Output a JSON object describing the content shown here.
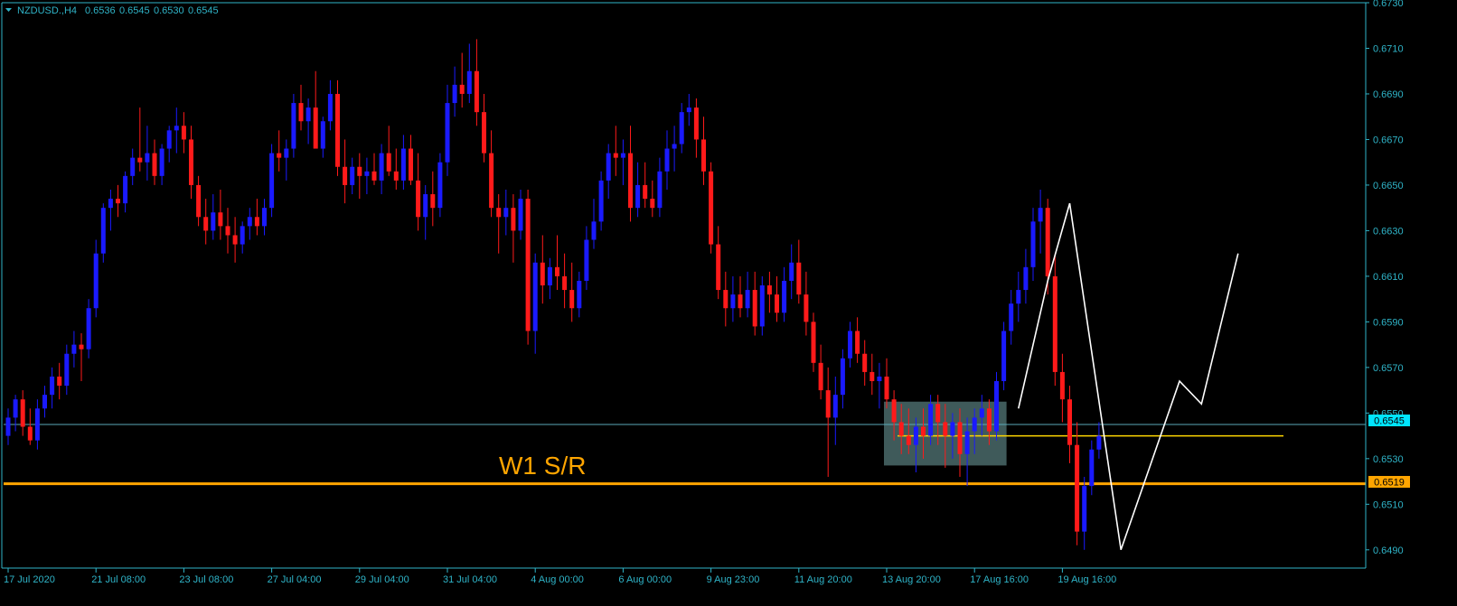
{
  "window": {
    "symbol_label": "NZDUSD.,H4",
    "ohlc": [
      "0.6536",
      "0.6545",
      "0.6530",
      "0.6545"
    ]
  },
  "colors": {
    "background": "#000000",
    "axis": "#2fb4c8",
    "bull": "#1a1aff",
    "bear": "#ff1a1a",
    "bid_line": "#5aa9b8",
    "support": "#ffa500",
    "zone_line": "#ffd700",
    "zone_box": "#4a6a6a",
    "projection": "#ffffff",
    "price_tag_current": "#00e5ff",
    "price_tag_support": "#ffa500"
  },
  "annotations": {
    "level_label": "W1 S/R",
    "current_price_tag": "0.6545",
    "support_price_tag": "0.6519"
  },
  "chart_data": {
    "type": "candlestick",
    "title": "",
    "xlabel": "",
    "ylabel": "",
    "ylim": [
      0.6482,
      0.673
    ],
    "y_ticks": [
      "0.6730",
      "0.6710",
      "0.6690",
      "0.6670",
      "0.6650",
      "0.6630",
      "0.6610",
      "0.6590",
      "0.6570",
      "0.6550",
      "0.6530",
      "0.6510",
      "0.6490"
    ],
    "x_ticks": [
      {
        "label": "17 Jul 2020",
        "index": 0
      },
      {
        "label": "21 Jul 08:00",
        "index": 12
      },
      {
        "label": "23 Jul 08:00",
        "index": 24
      },
      {
        "label": "27 Jul 04:00",
        "index": 36
      },
      {
        "label": "29 Jul 04:00",
        "index": 48
      },
      {
        "label": "31 Jul 04:00",
        "index": 60
      },
      {
        "label": "4 Aug 00:00",
        "index": 72
      },
      {
        "label": "6 Aug 00:00",
        "index": 84
      },
      {
        "label": "9 Aug 23:00",
        "index": 96
      },
      {
        "label": "11 Aug 20:00",
        "index": 108
      },
      {
        "label": "13 Aug 20:00",
        "index": 120
      },
      {
        "label": "17 Aug 16:00",
        "index": 132
      },
      {
        "label": "19 Aug 16:00",
        "index": 144
      }
    ],
    "candles": [
      [
        0.654,
        0.6552,
        0.6536,
        0.6548
      ],
      [
        0.6548,
        0.6558,
        0.6542,
        0.6556
      ],
      [
        0.6556,
        0.656,
        0.654,
        0.6544
      ],
      [
        0.6544,
        0.6552,
        0.6536,
        0.6538
      ],
      [
        0.6538,
        0.6556,
        0.6534,
        0.6552
      ],
      [
        0.6552,
        0.6562,
        0.6548,
        0.6558
      ],
      [
        0.6558,
        0.657,
        0.6552,
        0.6566
      ],
      [
        0.6566,
        0.6572,
        0.6556,
        0.6562
      ],
      [
        0.6562,
        0.658,
        0.6558,
        0.6576
      ],
      [
        0.6576,
        0.6586,
        0.657,
        0.658
      ],
      [
        0.658,
        0.6585,
        0.6564,
        0.6578
      ],
      [
        0.6578,
        0.66,
        0.6574,
        0.6596
      ],
      [
        0.6596,
        0.6626,
        0.6592,
        0.662
      ],
      [
        0.662,
        0.6642,
        0.6616,
        0.664
      ],
      [
        0.664,
        0.6648,
        0.663,
        0.6644
      ],
      [
        0.6644,
        0.665,
        0.6636,
        0.6642
      ],
      [
        0.6642,
        0.6656,
        0.6638,
        0.6654
      ],
      [
        0.6654,
        0.6666,
        0.665,
        0.6662
      ],
      [
        0.6662,
        0.6684,
        0.6656,
        0.666
      ],
      [
        0.666,
        0.6676,
        0.6652,
        0.6664
      ],
      [
        0.6664,
        0.667,
        0.665,
        0.6654
      ],
      [
        0.6654,
        0.6668,
        0.665,
        0.6666
      ],
      [
        0.6666,
        0.6676,
        0.666,
        0.6674
      ],
      [
        0.6674,
        0.6684,
        0.6664,
        0.6676
      ],
      [
        0.6676,
        0.6682,
        0.6664,
        0.667
      ],
      [
        0.667,
        0.6676,
        0.6644,
        0.665
      ],
      [
        0.665,
        0.6654,
        0.6632,
        0.6636
      ],
      [
        0.6636,
        0.6644,
        0.6624,
        0.663
      ],
      [
        0.663,
        0.6646,
        0.6626,
        0.6638
      ],
      [
        0.6638,
        0.6648,
        0.6626,
        0.6632
      ],
      [
        0.6632,
        0.664,
        0.662,
        0.6628
      ],
      [
        0.6628,
        0.6636,
        0.6616,
        0.6624
      ],
      [
        0.6624,
        0.6634,
        0.662,
        0.6632
      ],
      [
        0.6632,
        0.664,
        0.6626,
        0.6636
      ],
      [
        0.6636,
        0.6644,
        0.6628,
        0.6632
      ],
      [
        0.6632,
        0.6644,
        0.6628,
        0.664
      ],
      [
        0.664,
        0.6668,
        0.6636,
        0.6664
      ],
      [
        0.6664,
        0.6674,
        0.6656,
        0.6662
      ],
      [
        0.6662,
        0.667,
        0.6652,
        0.6666
      ],
      [
        0.6666,
        0.669,
        0.6662,
        0.6686
      ],
      [
        0.6686,
        0.6694,
        0.6674,
        0.6678
      ],
      [
        0.6678,
        0.6688,
        0.6668,
        0.6684
      ],
      [
        0.6684,
        0.67,
        0.6674,
        0.6666
      ],
      [
        0.6666,
        0.668,
        0.6662,
        0.6678
      ],
      [
        0.6678,
        0.6696,
        0.6674,
        0.669
      ],
      [
        0.669,
        0.6696,
        0.6654,
        0.6658
      ],
      [
        0.6658,
        0.667,
        0.6642,
        0.665
      ],
      [
        0.665,
        0.6662,
        0.6646,
        0.6658
      ],
      [
        0.6658,
        0.6664,
        0.6644,
        0.6654
      ],
      [
        0.6654,
        0.6662,
        0.6646,
        0.6656
      ],
      [
        0.6656,
        0.6664,
        0.665,
        0.6652
      ],
      [
        0.6652,
        0.6668,
        0.6646,
        0.6664
      ],
      [
        0.6664,
        0.6676,
        0.6654,
        0.6656
      ],
      [
        0.6656,
        0.6666,
        0.6648,
        0.6652
      ],
      [
        0.6652,
        0.6672,
        0.6648,
        0.6666
      ],
      [
        0.6666,
        0.6672,
        0.665,
        0.6652
      ],
      [
        0.6652,
        0.6664,
        0.663,
        0.6636
      ],
      [
        0.6636,
        0.665,
        0.6626,
        0.6646
      ],
      [
        0.6646,
        0.6656,
        0.6632,
        0.664
      ],
      [
        0.664,
        0.6664,
        0.6636,
        0.666
      ],
      [
        0.666,
        0.6694,
        0.6654,
        0.6686
      ],
      [
        0.6686,
        0.6702,
        0.668,
        0.6694
      ],
      [
        0.6694,
        0.6708,
        0.6684,
        0.669
      ],
      [
        0.669,
        0.6712,
        0.6686,
        0.67
      ],
      [
        0.67,
        0.6714,
        0.6676,
        0.6682
      ],
      [
        0.6682,
        0.669,
        0.666,
        0.6664
      ],
      [
        0.6664,
        0.6674,
        0.6636,
        0.664
      ],
      [
        0.664,
        0.6646,
        0.662,
        0.6636
      ],
      [
        0.6636,
        0.6648,
        0.6628,
        0.664
      ],
      [
        0.664,
        0.6646,
        0.6616,
        0.663
      ],
      [
        0.663,
        0.6648,
        0.6626,
        0.6644
      ],
      [
        0.6644,
        0.6648,
        0.658,
        0.6586
      ],
      [
        0.6586,
        0.662,
        0.6576,
        0.6616
      ],
      [
        0.6616,
        0.6628,
        0.6598,
        0.6606
      ],
      [
        0.6606,
        0.6618,
        0.66,
        0.6614
      ],
      [
        0.6614,
        0.6628,
        0.6604,
        0.661
      ],
      [
        0.661,
        0.662,
        0.6596,
        0.6604
      ],
      [
        0.6604,
        0.6616,
        0.659,
        0.6596
      ],
      [
        0.6596,
        0.6612,
        0.6592,
        0.6608
      ],
      [
        0.6608,
        0.6632,
        0.6604,
        0.6626
      ],
      [
        0.6626,
        0.6644,
        0.6622,
        0.6634
      ],
      [
        0.6634,
        0.6656,
        0.663,
        0.6652
      ],
      [
        0.6652,
        0.6668,
        0.6644,
        0.6664
      ],
      [
        0.6664,
        0.6676,
        0.6654,
        0.6662
      ],
      [
        0.6662,
        0.667,
        0.665,
        0.6664
      ],
      [
        0.6664,
        0.6676,
        0.6634,
        0.664
      ],
      [
        0.664,
        0.666,
        0.6636,
        0.665
      ],
      [
        0.665,
        0.666,
        0.664,
        0.6644
      ],
      [
        0.6644,
        0.6652,
        0.6636,
        0.664
      ],
      [
        0.664,
        0.6662,
        0.6636,
        0.6656
      ],
      [
        0.6656,
        0.6674,
        0.6648,
        0.6666
      ],
      [
        0.6666,
        0.6676,
        0.6656,
        0.6668
      ],
      [
        0.6668,
        0.6686,
        0.6664,
        0.6682
      ],
      [
        0.6682,
        0.669,
        0.6676,
        0.6684
      ],
      [
        0.6684,
        0.6688,
        0.6662,
        0.667
      ],
      [
        0.667,
        0.668,
        0.665,
        0.6656
      ],
      [
        0.6656,
        0.666,
        0.662,
        0.6624
      ],
      [
        0.6624,
        0.6632,
        0.66,
        0.6604
      ],
      [
        0.6604,
        0.6612,
        0.6588,
        0.6596
      ],
      [
        0.6596,
        0.661,
        0.659,
        0.6602
      ],
      [
        0.6602,
        0.661,
        0.6592,
        0.6596
      ],
      [
        0.6596,
        0.6612,
        0.6592,
        0.6604
      ],
      [
        0.6604,
        0.6612,
        0.6584,
        0.6588
      ],
      [
        0.6588,
        0.661,
        0.6584,
        0.6606
      ],
      [
        0.6606,
        0.6612,
        0.6594,
        0.6602
      ],
      [
        0.6602,
        0.661,
        0.659,
        0.6594
      ],
      [
        0.6594,
        0.6614,
        0.659,
        0.6608
      ],
      [
        0.6608,
        0.6624,
        0.66,
        0.6616
      ],
      [
        0.6616,
        0.6626,
        0.6598,
        0.6602
      ],
      [
        0.6602,
        0.6612,
        0.6584,
        0.659
      ],
      [
        0.659,
        0.6594,
        0.6568,
        0.6572
      ],
      [
        0.6572,
        0.658,
        0.6556,
        0.656
      ],
      [
        0.656,
        0.657,
        0.6522,
        0.6548
      ],
      [
        0.6548,
        0.6566,
        0.6536,
        0.6558
      ],
      [
        0.6558,
        0.6578,
        0.6552,
        0.6574
      ],
      [
        0.6574,
        0.659,
        0.657,
        0.6586
      ],
      [
        0.6586,
        0.6592,
        0.6572,
        0.6576
      ],
      [
        0.6576,
        0.6582,
        0.6562,
        0.6568
      ],
      [
        0.6568,
        0.6576,
        0.6558,
        0.6564
      ],
      [
        0.6564,
        0.6572,
        0.6552,
        0.6566
      ],
      [
        0.6566,
        0.6574,
        0.6552,
        0.6556
      ],
      [
        0.6556,
        0.656,
        0.6538,
        0.6546
      ],
      [
        0.6546,
        0.6554,
        0.6532,
        0.654
      ],
      [
        0.654,
        0.6552,
        0.6532,
        0.6536
      ],
      [
        0.6536,
        0.6548,
        0.6524,
        0.6544
      ],
      [
        0.6544,
        0.6552,
        0.653,
        0.654
      ],
      [
        0.654,
        0.6558,
        0.6536,
        0.6554
      ],
      [
        0.6554,
        0.6558,
        0.6536,
        0.6546
      ],
      [
        0.6546,
        0.6554,
        0.6526,
        0.654
      ],
      [
        0.654,
        0.655,
        0.653,
        0.6546
      ],
      [
        0.6546,
        0.6552,
        0.6522,
        0.6532
      ],
      [
        0.6532,
        0.6548,
        0.6518,
        0.6542
      ],
      [
        0.6542,
        0.6552,
        0.6532,
        0.6548
      ],
      [
        0.6548,
        0.6558,
        0.654,
        0.6552
      ],
      [
        0.6552,
        0.6556,
        0.6536,
        0.6542
      ],
      [
        0.6542,
        0.6568,
        0.6538,
        0.6564
      ],
      [
        0.6564,
        0.659,
        0.656,
        0.6586
      ],
      [
        0.6586,
        0.6604,
        0.658,
        0.6598
      ],
      [
        0.6598,
        0.6612,
        0.659,
        0.6604
      ],
      [
        0.6604,
        0.6622,
        0.6598,
        0.6614
      ],
      [
        0.6614,
        0.664,
        0.6608,
        0.6634
      ],
      [
        0.6634,
        0.6648,
        0.662,
        0.664
      ],
      [
        0.664,
        0.6644,
        0.6602,
        0.661
      ],
      [
        0.661,
        0.662,
        0.6562,
        0.6568
      ],
      [
        0.6568,
        0.6576,
        0.6546,
        0.6556
      ],
      [
        0.6556,
        0.6562,
        0.6528,
        0.6536
      ],
      [
        0.6536,
        0.6546,
        0.6492,
        0.6498
      ],
      [
        0.6498,
        0.6522,
        0.649,
        0.6518
      ],
      [
        0.6518,
        0.6538,
        0.6514,
        0.6534
      ],
      [
        0.6534,
        0.6546,
        0.653,
        0.654
      ]
    ],
    "levels": {
      "current_price": 0.6545,
      "w1_support_resistance": 0.6519,
      "zone_line": 0.654,
      "zone_box": {
        "start_index": 120,
        "end_index": 136,
        "top": 0.6555,
        "bottom": 0.6527
      }
    },
    "projection_path": [
      [
        138,
        0.6552
      ],
      [
        142,
        0.6608
      ],
      [
        145,
        0.6642
      ],
      [
        152,
        0.649
      ],
      [
        160,
        0.6564
      ],
      [
        163,
        0.6554
      ],
      [
        168,
        0.662
      ]
    ]
  }
}
